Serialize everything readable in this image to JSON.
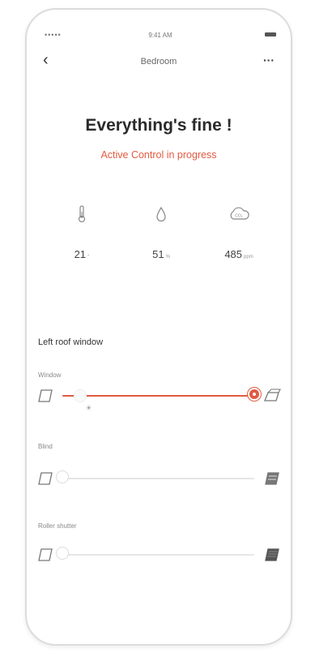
{
  "status_bar": {
    "signal": "•••••",
    "time": "9:41 AM"
  },
  "nav": {
    "back_icon": "chevron-left-icon",
    "title": "Bedroom",
    "more_icon": "more-dots-icon"
  },
  "status": {
    "headline": "Everything's fine !",
    "subline": "Active Control in progress"
  },
  "metrics": [
    {
      "icon": "thermometer-icon",
      "value": "21",
      "unit": "°"
    },
    {
      "icon": "humidity-drop-icon",
      "value": "51",
      "unit": "%"
    },
    {
      "icon": "co2-cloud-icon",
      "value": "485",
      "unit": "ppm"
    }
  ],
  "section": {
    "title": "Left roof window"
  },
  "controls": [
    {
      "label": "Window",
      "level_percent": 100,
      "left_icon": "window-closed-icon",
      "right_icon": "window-open-icon",
      "marker": "☀"
    },
    {
      "label": "Blind",
      "level_percent": 0,
      "left_icon": "window-closed-icon",
      "right_icon": "blind-closed-icon"
    },
    {
      "label": "Roller shutter",
      "level_percent": 0,
      "left_icon": "window-closed-icon",
      "right_icon": "shutter-closed-icon"
    }
  ],
  "colors": {
    "accent": "#e25a41",
    "text": "#2b2b2b",
    "muted": "#888888"
  }
}
